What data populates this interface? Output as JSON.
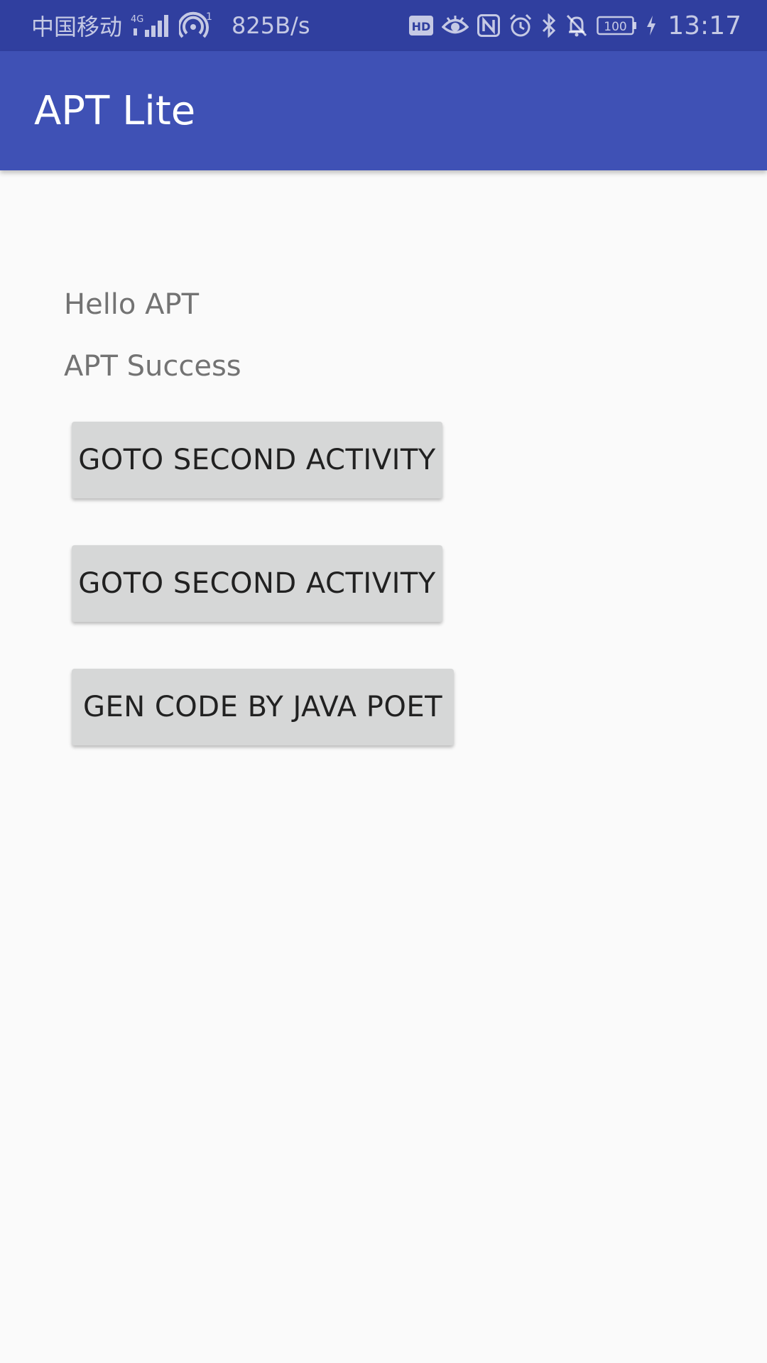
{
  "status_bar": {
    "carrier": "中国移动",
    "network_type": "4G",
    "hotspot_badge": "1",
    "speed": "825B/s",
    "hd_label": "HD",
    "battery": "100",
    "time": "13:17",
    "icons": [
      "signal-icon",
      "hotspot-icon",
      "hd-icon",
      "eye-icon",
      "nfc-icon",
      "alarm-icon",
      "bluetooth-icon",
      "mute-bell-icon",
      "battery-icon",
      "charging-icon"
    ],
    "color": "#303f9f"
  },
  "app_bar": {
    "title": "APT Lite",
    "color": "#3f51b5"
  },
  "main": {
    "hello_text": "Hello APT",
    "success_text": "APT Success",
    "buttons": [
      {
        "label": "GOTO SECOND ACTIVITY"
      },
      {
        "label": "GOTO SECOND ACTIVITY"
      },
      {
        "label": "GEN CODE BY JAVA POET"
      }
    ],
    "button_color": "#d6d7d7",
    "background": "#fafafa"
  }
}
